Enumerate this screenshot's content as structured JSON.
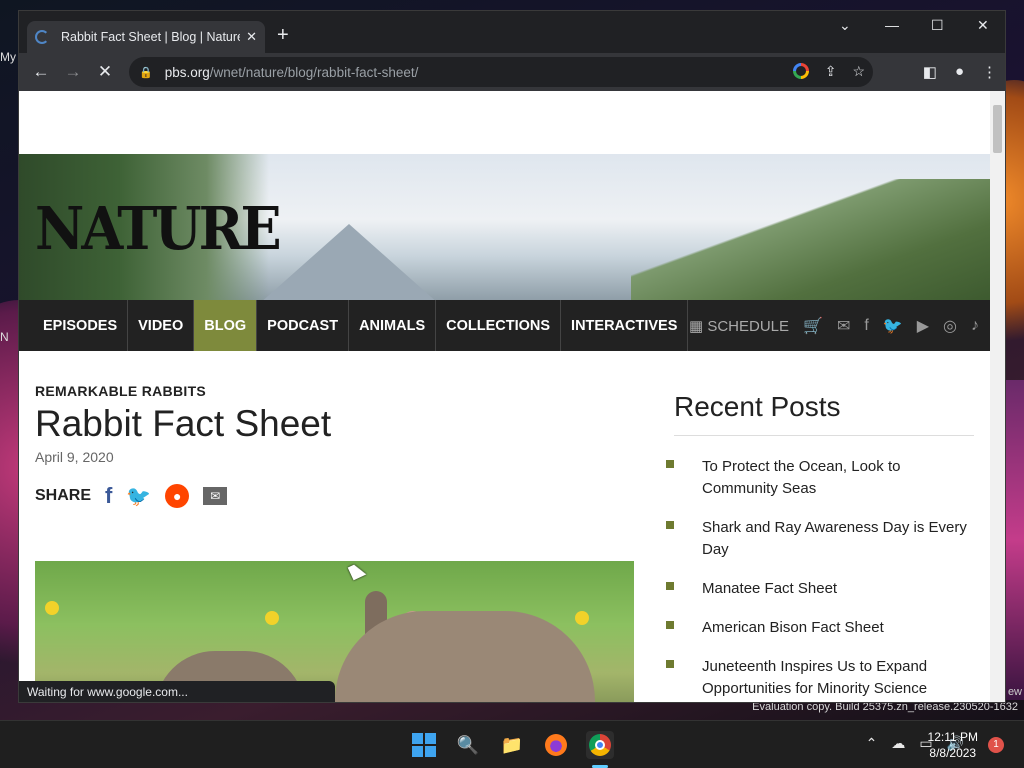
{
  "desktop": {
    "left_text": "My",
    "left_text2": "N",
    "right_text": "ew",
    "evaluation": "Evaluation copy. Build 25375.zn_release.230520-1632"
  },
  "browser": {
    "tab_title": "Rabbit Fact Sheet | Blog | Nature",
    "url_domain": "pbs.org",
    "url_path": "/wnet/nature/blog/rabbit-fact-sheet/",
    "status_text": "Waiting for www.google.com..."
  },
  "site": {
    "logo": "NATURE",
    "nav": [
      "EPISODES",
      "VIDEO",
      "BLOG",
      "PODCAST",
      "ANIMALS",
      "COLLECTIONS",
      "INTERACTIVES"
    ],
    "active_nav": "BLOG",
    "schedule_label": "SCHEDULE"
  },
  "article": {
    "eyebrow": "REMARKABLE RABBITS",
    "title": "Rabbit Fact Sheet",
    "date": "April 9, 2020",
    "share_label": "SHARE"
  },
  "sidebar": {
    "title": "Recent Posts",
    "posts": [
      "To Protect the Ocean, Look to Community Seas",
      "Shark and Ray Awareness Day is Every Day",
      "Manatee Fact Sheet",
      "American Bison Fact Sheet",
      "Juneteenth Inspires Us to Expand Opportunities for Minority Science"
    ]
  },
  "taskbar": {
    "time": "12:11 PM",
    "date": "8/8/2023",
    "notification_count": "1"
  },
  "colors": {
    "nav_active": "#7e8a3c",
    "navbar_bg": "#222222",
    "chrome_dark": "#202124"
  }
}
